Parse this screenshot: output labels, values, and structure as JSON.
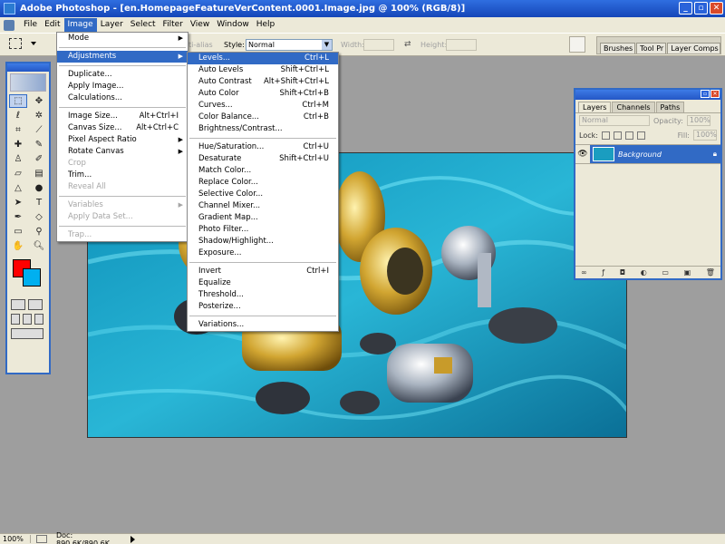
{
  "window": {
    "title": "Adobe Photoshop - [en.HomepageFeatureVerContent.0001.Image.jpg @ 100% (RGB/8)]"
  },
  "menubar": [
    "File",
    "Edit",
    "Image",
    "Layer",
    "Select",
    "Filter",
    "View",
    "Window",
    "Help"
  ],
  "active_menu": "Image",
  "options_bar": {
    "antialias": "ti-alias",
    "style_label": "Style:",
    "style_value": "Normal",
    "width_label": "Width:",
    "height_label": "Height:"
  },
  "palette_well": [
    "Brushes",
    "Tool Pr",
    "Layer Comps"
  ],
  "image_menu": [
    {
      "label": "Mode",
      "submenu": true
    },
    {
      "sep": true
    },
    {
      "label": "Adjustments",
      "submenu": true,
      "highlight": true
    },
    {
      "sep": true
    },
    {
      "label": "Duplicate..."
    },
    {
      "label": "Apply Image..."
    },
    {
      "label": "Calculations..."
    },
    {
      "sep": true
    },
    {
      "label": "Image Size...",
      "shortcut": "Alt+Ctrl+I"
    },
    {
      "label": "Canvas Size...",
      "shortcut": "Alt+Ctrl+C"
    },
    {
      "label": "Pixel Aspect Ratio",
      "submenu": true
    },
    {
      "label": "Rotate Canvas",
      "submenu": true
    },
    {
      "label": "Crop",
      "disabled": true
    },
    {
      "label": "Trim..."
    },
    {
      "label": "Reveal All",
      "disabled": true
    },
    {
      "sep": true
    },
    {
      "label": "Variables",
      "submenu": true,
      "disabled": true
    },
    {
      "label": "Apply Data Set...",
      "disabled": true
    },
    {
      "sep": true
    },
    {
      "label": "Trap...",
      "disabled": true
    }
  ],
  "adjustments_menu": [
    {
      "label": "Levels...",
      "shortcut": "Ctrl+L",
      "highlight": true
    },
    {
      "label": "Auto Levels",
      "shortcut": "Shift+Ctrl+L"
    },
    {
      "label": "Auto Contrast",
      "shortcut": "Alt+Shift+Ctrl+L"
    },
    {
      "label": "Auto Color",
      "shortcut": "Shift+Ctrl+B"
    },
    {
      "label": "Curves...",
      "shortcut": "Ctrl+M"
    },
    {
      "label": "Color Balance...",
      "shortcut": "Ctrl+B"
    },
    {
      "label": "Brightness/Contrast..."
    },
    {
      "sep": true
    },
    {
      "label": "Hue/Saturation...",
      "shortcut": "Ctrl+U"
    },
    {
      "label": "Desaturate",
      "shortcut": "Shift+Ctrl+U"
    },
    {
      "label": "Match Color..."
    },
    {
      "label": "Replace Color..."
    },
    {
      "label": "Selective Color..."
    },
    {
      "label": "Channel Mixer..."
    },
    {
      "label": "Gradient Map..."
    },
    {
      "label": "Photo Filter..."
    },
    {
      "label": "Shadow/Highlight..."
    },
    {
      "label": "Exposure..."
    },
    {
      "sep": true
    },
    {
      "label": "Invert",
      "shortcut": "Ctrl+I"
    },
    {
      "label": "Equalize"
    },
    {
      "label": "Threshold..."
    },
    {
      "label": "Posterize..."
    },
    {
      "sep": true
    },
    {
      "label": "Variations..."
    }
  ],
  "layers_panel": {
    "tabs": [
      "Layers",
      "Channels",
      "Paths"
    ],
    "active_tab": "Layers",
    "blend_mode": "Normal",
    "opacity_label": "Opacity:",
    "opacity_value": "100%",
    "lock_label": "Lock:",
    "fill_label": "Fill:",
    "fill_value": "100%",
    "layer_name": "Background"
  },
  "statusbar": {
    "zoom": "100%",
    "doc": "Doc: 890.6K/890.6K"
  },
  "colors": {
    "foreground": "#ff0000",
    "background": "#00b0f0",
    "accent": "#316ac5"
  }
}
